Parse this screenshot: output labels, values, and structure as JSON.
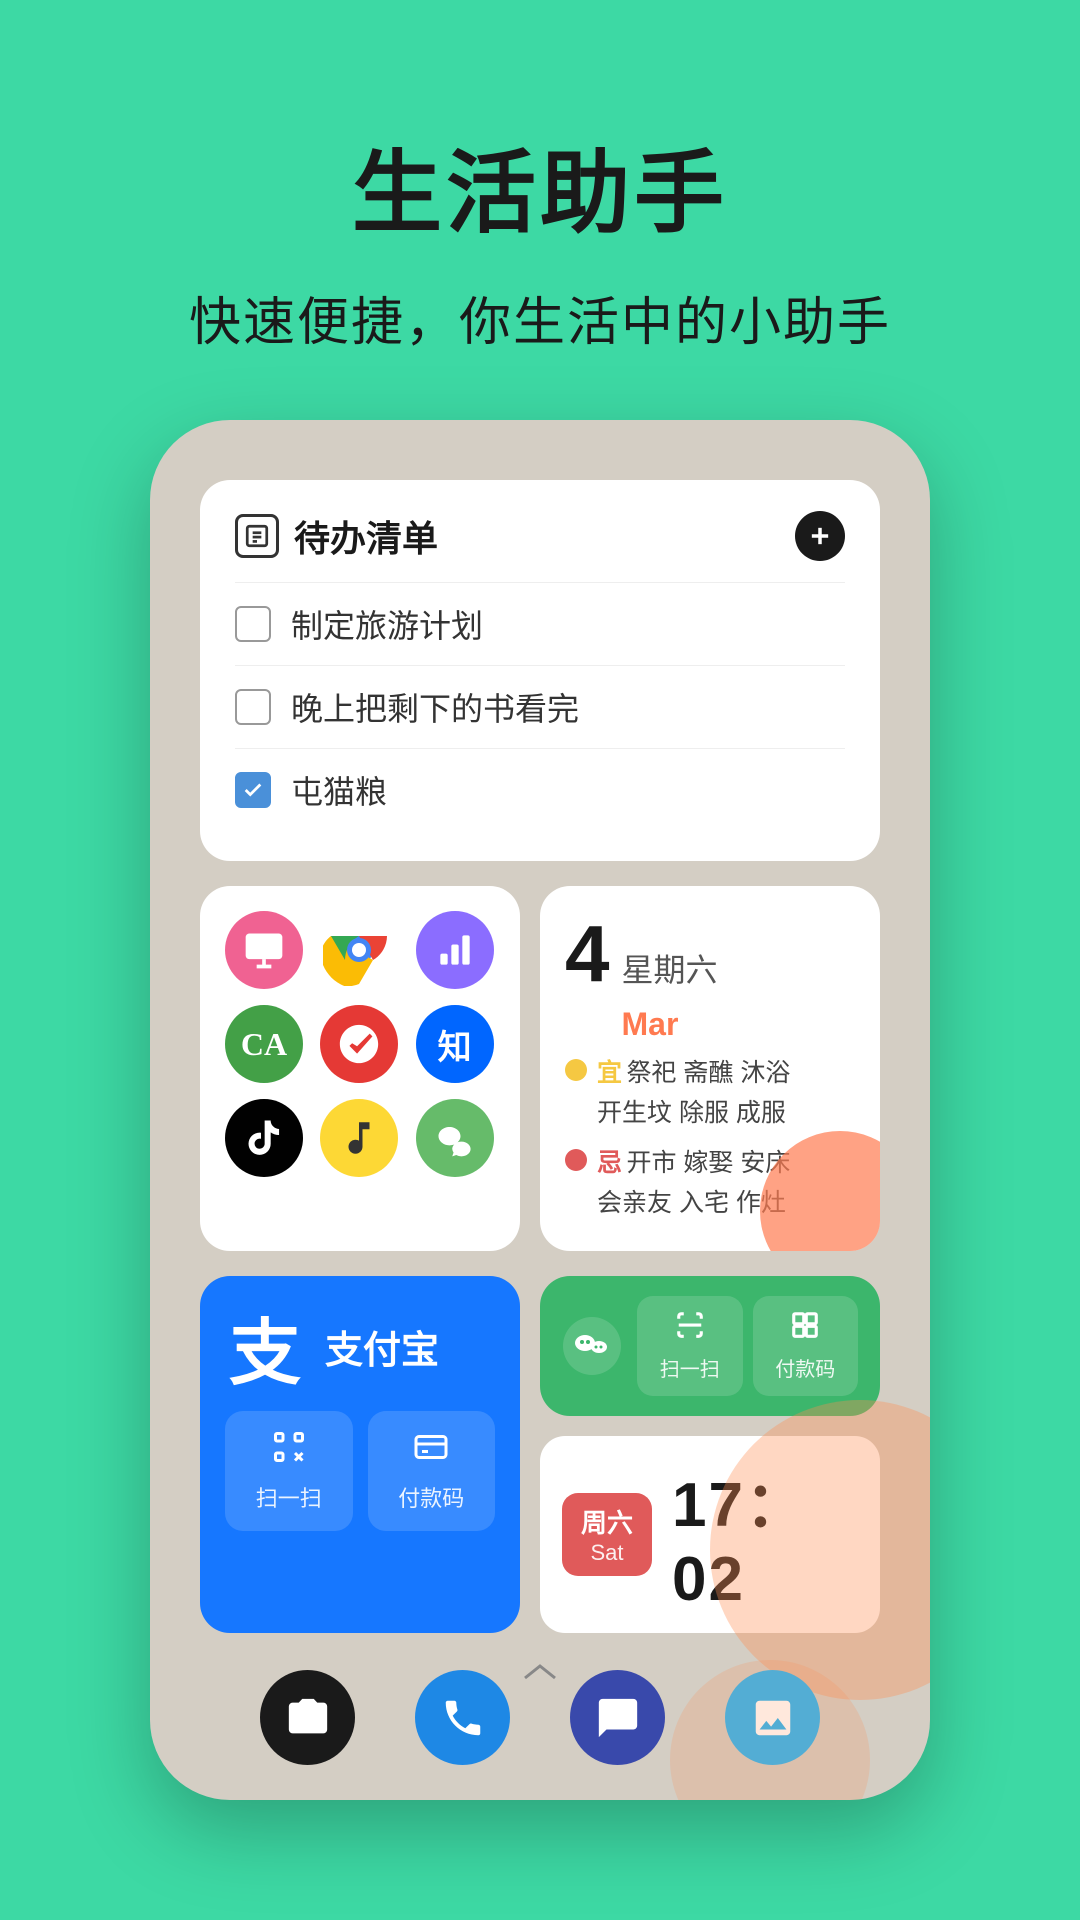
{
  "header": {
    "main_title": "生活助手",
    "sub_title": "快速便捷，你生活中的小助手"
  },
  "todo_widget": {
    "title": "待办清单",
    "add_btn_label": "+",
    "items": [
      {
        "text": "制定旅游计划",
        "checked": false
      },
      {
        "text": "晚上把剩下的书看完",
        "checked": false
      },
      {
        "text": "屯猫粮",
        "checked": true
      }
    ]
  },
  "calendar_widget": {
    "date": "4",
    "weekday": "星期六",
    "month": "Mar",
    "auspicious_label": "宜",
    "auspicious_items": "祭祀  斋醮  沐浴\n开生坟  除服  成服",
    "inauspicious_label": "忌",
    "inauspicious_items": "开市  嫁娶  安床\n会亲友  入宅  作灶"
  },
  "alipay_widget": {
    "char": "支",
    "name": "支付宝",
    "scan_label": "扫一扫",
    "pay_label": "付款码"
  },
  "wechat_widget": {
    "scan_label": "扫一扫",
    "pay_label": "付款码"
  },
  "clock_widget": {
    "weekday": "周六",
    "day_abbr": "Sat",
    "time": "17：02"
  },
  "dock": {
    "items": [
      {
        "name": "camera",
        "color": "#1a1a1a",
        "icon": "📷"
      },
      {
        "name": "phone",
        "color": "#1E88E5",
        "icon": "📞"
      },
      {
        "name": "messages",
        "color": "#3949AB",
        "icon": "💬"
      },
      {
        "name": "gallery",
        "color": "#29B6F6",
        "icon": "🖼"
      }
    ]
  }
}
